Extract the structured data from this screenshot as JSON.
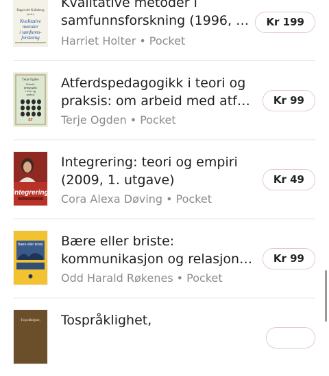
{
  "books": [
    {
      "title_line1": "Kvalitative metoder i",
      "title_line2": "samfunnsforskning (1996, 2…",
      "author": "Harriet Holter",
      "format": "Pocket",
      "price": "Kr 199",
      "cover": {
        "bg": "#f4f1e6",
        "text1": "Hagevold Kalleberg",
        "text2": "Kvalitative metoder i samfunns-forskning"
      }
    },
    {
      "title_line1": "Atferdspedagogikk i teori og",
      "title_line2": "praksis: om arbeid med atfe…",
      "author": "Terje Ogden",
      "format": "Pocket",
      "price": "Kr 99",
      "cover": {
        "bg": "#dce8d2",
        "text1": "Terje Ogden",
        "text2": "Atferdspedagogikk i teori og praksis"
      }
    },
    {
      "title_line1": "Integrering: teori og empiri",
      "title_line2": "(2009, 1. utgave)",
      "author": "Cora Alexa Døving",
      "format": "Pocket",
      "price": "Kr 49",
      "cover": {
        "bg": "#c0392b",
        "text1": "integrering"
      }
    },
    {
      "title_line1": "Bære eller briste:",
      "title_line2": "kommunikasjon og relasjon…",
      "author": "Odd Harald Røkenes",
      "format": "Pocket",
      "price": "Kr 99",
      "cover": {
        "bg": "#f2c230",
        "text1": "Bære eller briste"
      }
    },
    {
      "title_line1": "Tospråklighet,",
      "title_line2": "",
      "author": "",
      "format": "",
      "price": "",
      "cover": {
        "bg": "#6b4e2a",
        "text1": "Tospråklighet,"
      }
    }
  ],
  "separator": "•"
}
